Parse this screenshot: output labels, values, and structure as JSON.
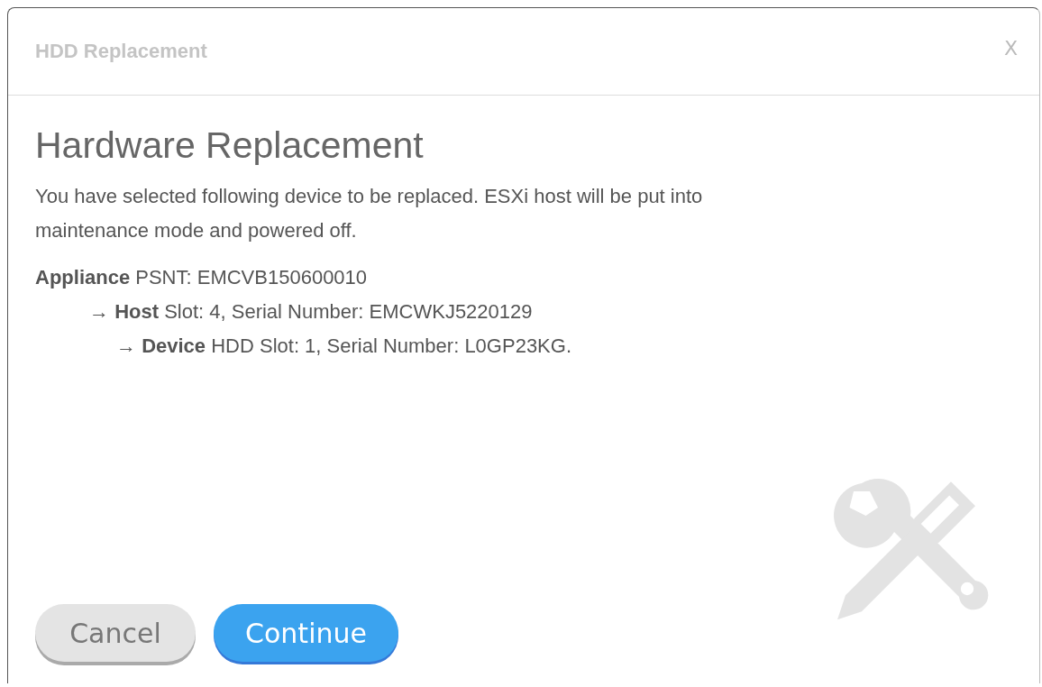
{
  "dialog": {
    "title": "HDD Replacement",
    "close": "X"
  },
  "heading": "Hardware Replacement",
  "message": "You have selected following device to be replaced. ESXi host will be put into maintenance mode and powered off.",
  "tree": [
    {
      "text": "**Appliance** PSNT: EMCVB150600010",
      "children": [
        {
          "text": "→ **Host** Slot: 4, Serial Number: EMCWKJ5220129",
          "children": [
            {
              "text": "→ **Device** HDD Slot: 1, Serial Number: L0GP23KG."
            }
          ]
        }
      ]
    }
  ],
  "buttons": [
    {
      "label": "Cancel",
      "kind": "secondary"
    },
    {
      "label": "Continue",
      "kind": "primary"
    }
  ]
}
